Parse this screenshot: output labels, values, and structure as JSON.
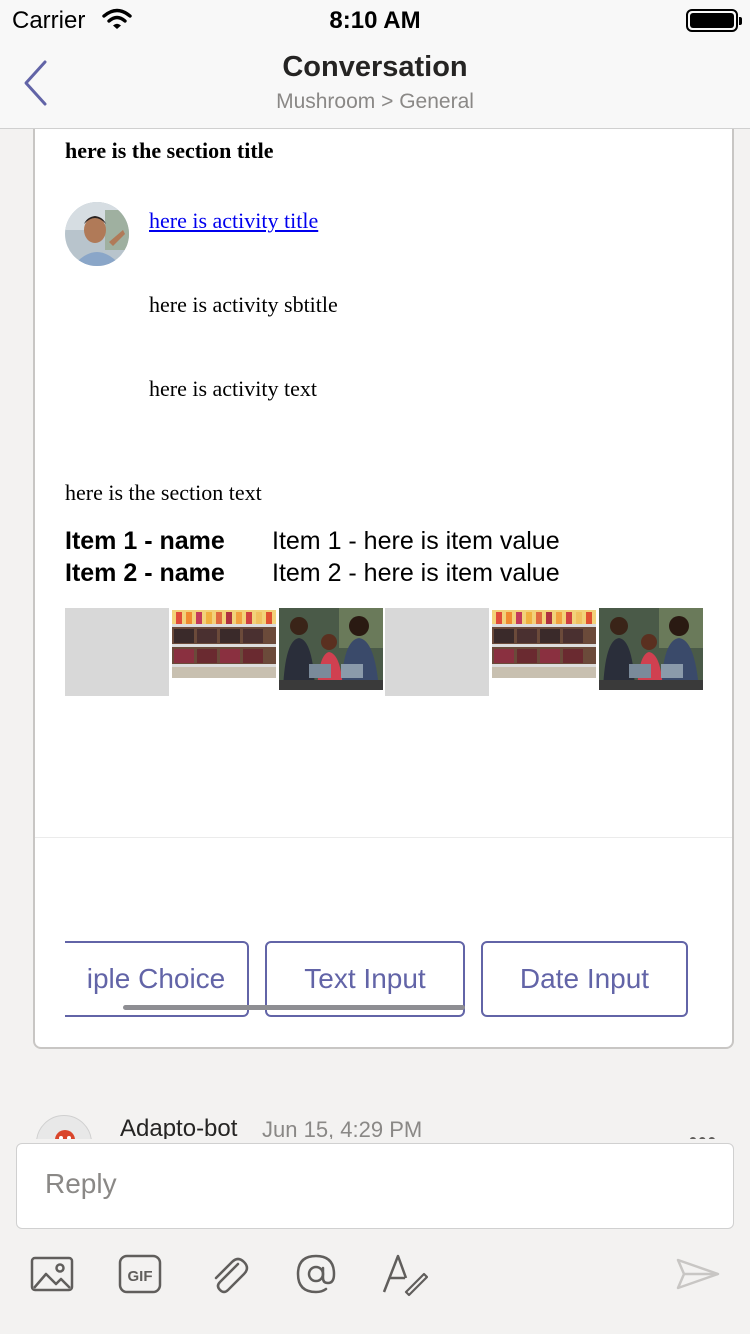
{
  "status": {
    "carrier": "Carrier",
    "time": "8:10 AM"
  },
  "nav": {
    "title": "Conversation",
    "subtitle": "Mushroom > General"
  },
  "card": {
    "section_title": "here is the section title",
    "activity_title": "here is activity title",
    "activity_subtitle": "here is activity sbtitle",
    "activity_text": "here is activity text",
    "section_text": "here is the section text",
    "facts": [
      {
        "name": "Item 1 - name",
        "value": "Item 1 - here is item value"
      },
      {
        "name": "Item 2 - name",
        "value": "Item 2 - here is item value"
      }
    ],
    "actions": [
      "iple Choice",
      "Text Input",
      "Date Input"
    ]
  },
  "next_message": {
    "author": "Adapto-bot",
    "time": "Jun 15, 4:29 PM"
  },
  "compose": {
    "placeholder": "Reply"
  },
  "colors": {
    "accent": "#6264a7",
    "link": "#0000ee",
    "background": "#f3f2f1"
  }
}
